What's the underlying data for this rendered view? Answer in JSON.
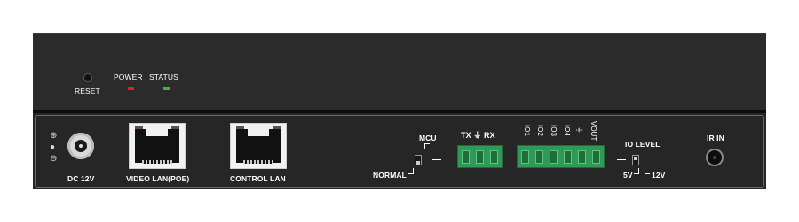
{
  "top_panel": {
    "reset_label": "RESET",
    "power_label": "POWER",
    "status_label": "STATUS",
    "power_led_color": "#e02020",
    "status_led_color": "#21c24a"
  },
  "front_panel": {
    "dc_label": "DC 12V",
    "dc_polarity_symbols": [
      "⊕",
      "●",
      "⊖"
    ],
    "video_lan_label": "VIDEO LAN(POE)",
    "control_lan_label": "CONTROL LAN",
    "mcu_label": "MCU",
    "normal_label": "NORMAL",
    "tx_rx_label": "TX ⏚ RX",
    "io_labels": [
      "IO1",
      "IO2",
      "IO3",
      "IO4",
      "⏚",
      "VOUT"
    ],
    "io_level_label": "IO LEVEL",
    "io_5v_label": "5V",
    "io_12v_label": "12V",
    "ir_in_label": "IR IN"
  },
  "colors": {
    "terminal_green": "#2f9a55",
    "panel_dark": "#262626"
  }
}
